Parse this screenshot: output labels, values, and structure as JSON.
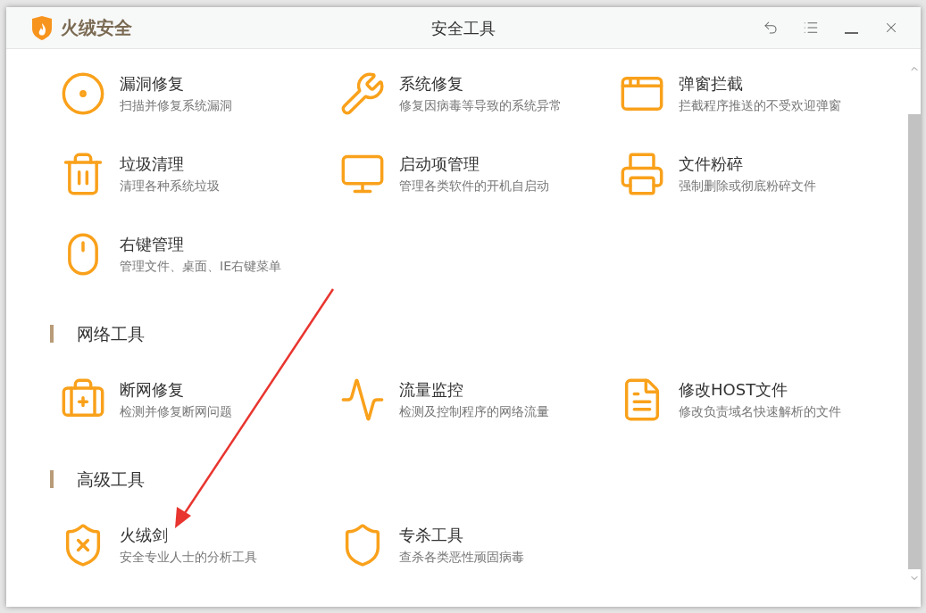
{
  "window": {
    "brand": "火绒安全",
    "title": "安全工具"
  },
  "sections": [
    {
      "tools": [
        {
          "name": "漏洞修复",
          "desc": "扫描并修复系统漏洞"
        },
        {
          "name": "系统修复",
          "desc": "修复因病毒等导致的系统异常"
        },
        {
          "name": "弹窗拦截",
          "desc": "拦截程序推送的不受欢迎弹窗"
        },
        {
          "name": "垃圾清理",
          "desc": "清理各种系统垃圾"
        },
        {
          "name": "启动项管理",
          "desc": "管理各类软件的开机自启动"
        },
        {
          "name": "文件粉碎",
          "desc": "强制删除或彻底粉碎文件"
        },
        {
          "name": "右键管理",
          "desc": "管理文件、桌面、IE右键菜单"
        }
      ]
    },
    {
      "title": "网络工具",
      "tools": [
        {
          "name": "断网修复",
          "desc": "检测并修复断网问题"
        },
        {
          "name": "流量监控",
          "desc": "检测及控制程序的网络流量"
        },
        {
          "name": "修改HOST文件",
          "desc": "修改负责域名快速解析的文件"
        }
      ]
    },
    {
      "title": "高级工具",
      "tools": [
        {
          "name": "火绒剑",
          "desc": "安全专业人士的分析工具"
        },
        {
          "name": "专杀工具",
          "desc": "查杀各类恶性顽固病毒"
        }
      ]
    }
  ]
}
